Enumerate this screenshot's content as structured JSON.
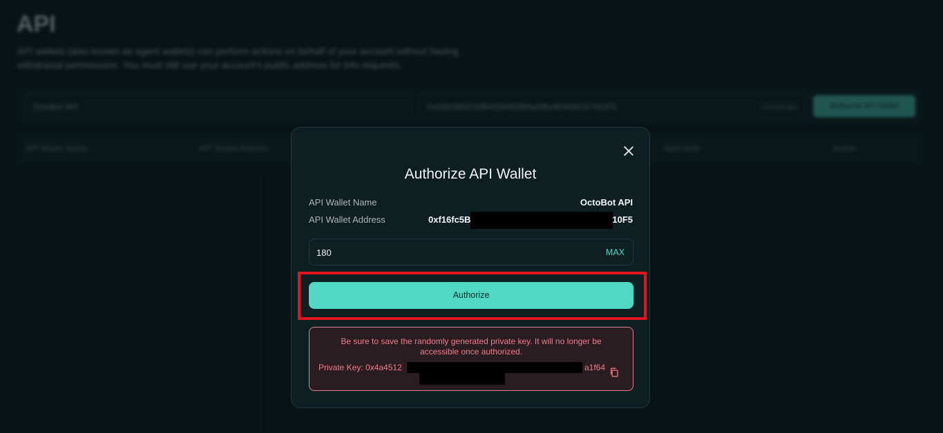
{
  "background": {
    "page_title": "API",
    "description": "API wallets (also known as agent wallets) can perform actions on behalf of your account without having withdrawal permissions. You must still use your account's public address for info requests.",
    "name_input_value": "OctoBot API",
    "address_input_value": "0xf16fc5B223dB41D4903Bfad3814f0408C87410F5",
    "generate_label": "Generate",
    "authorize_button_label": "Authorize API Wallet",
    "table_headers": [
      "API Wallet Name",
      "API Wallet Address",
      "Valid Until",
      "Action"
    ]
  },
  "modal": {
    "title": "Authorize API Wallet",
    "wallet_name_label": "API Wallet Name",
    "wallet_name_value": "OctoBot API",
    "wallet_address_label": "API Wallet Address",
    "wallet_address_prefix": "0xf16fc5B2",
    "wallet_address_suffix": "10F5",
    "days_value": "180",
    "max_label": "MAX",
    "authorize_label": "Authorize",
    "warning_text": "Be sure to save the randomly generated private key. It will no longer be accessible once authorized.",
    "private_key_label": "Private Key: 0x4a4512",
    "private_key_suffix": "a1f64"
  },
  "colors": {
    "accent": "#50d8c4",
    "warning": "#f27c8c",
    "highlight": "#e3141f"
  }
}
